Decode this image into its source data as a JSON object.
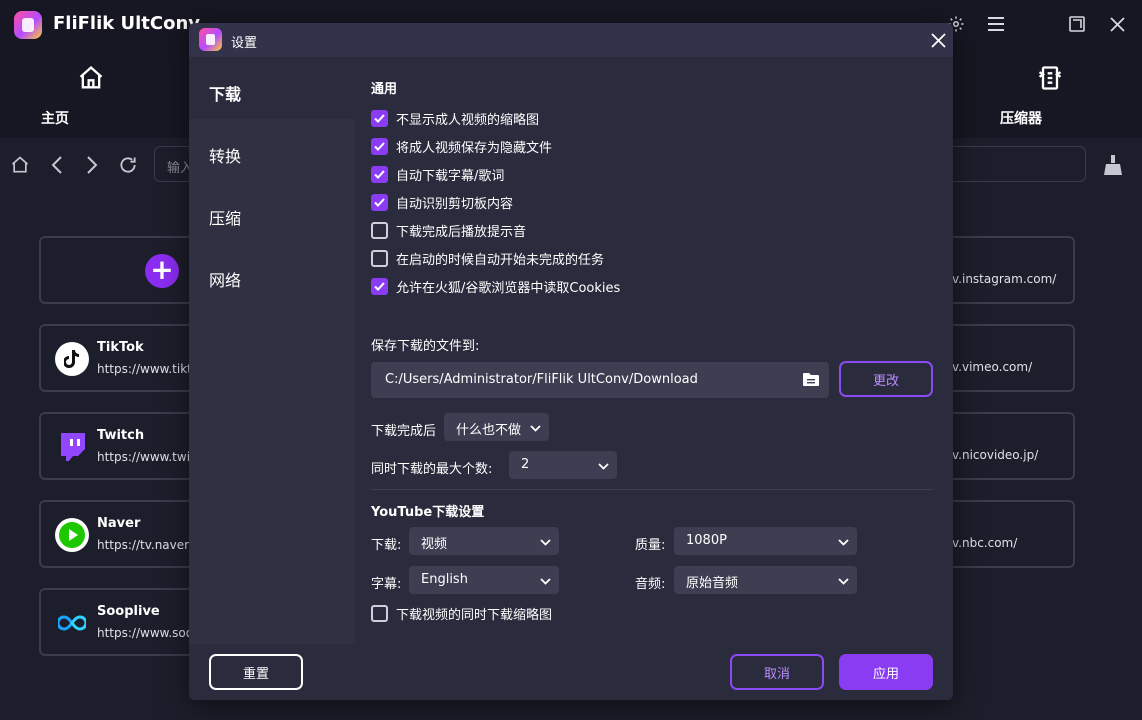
{
  "app": {
    "title": "FliFlik UltConv",
    "icons": [
      "settings-icon",
      "menu-icon",
      "maximize-icon",
      "close-icon"
    ]
  },
  "nav": {
    "home_label": "主页",
    "compressor_label": "压缩器"
  },
  "browser": {
    "url_placeholder": "输入"
  },
  "sites": {
    "tiktok": {
      "name": "TikTok",
      "url": "https://www.tiktc"
    },
    "twitch": {
      "name": "Twitch",
      "url": "https://www.twitc"
    },
    "naver": {
      "name": "Naver",
      "url": "https://tv.naver.c"
    },
    "sooplive": {
      "name": "Sooplive",
      "url": "https://www.soop"
    },
    "right_urls": [
      "v.instagram.com/",
      "v.vimeo.com/",
      "v.nicovideo.jp/",
      "v.nbc.com/"
    ]
  },
  "dialog": {
    "title": "设置",
    "sidebar": [
      {
        "label": "下载",
        "active": true
      },
      {
        "label": "转换",
        "active": false
      },
      {
        "label": "压缩",
        "active": false
      },
      {
        "label": "网络",
        "active": false
      }
    ],
    "general": {
      "section_title": "通用",
      "checkboxes": [
        {
          "label": "不显示成人视频的缩略图",
          "checked": true
        },
        {
          "label": "将成人视频保存为隐藏文件",
          "checked": true
        },
        {
          "label": "自动下载字幕/歌词",
          "checked": true
        },
        {
          "label": "自动识别剪切板内容",
          "checked": true
        },
        {
          "label": "下载完成后播放提示音",
          "checked": false
        },
        {
          "label": "在启动的时候自动开始未完成的任务",
          "checked": false
        },
        {
          "label": "允许在火狐/谷歌浏览器中读取Cookies",
          "checked": true
        }
      ],
      "save_to_label": "保存下载的文件到:",
      "save_path": "C:/Users/Administrator/FliFlik UltConv/Download",
      "change_button": "更改",
      "after_download_label": "下载完成后",
      "after_download_value": "什么也不做",
      "max_concurrent_label": "同时下载的最大个数:",
      "max_concurrent_value": "2"
    },
    "youtube": {
      "section_title": "YouTube下载设置",
      "download_label": "下载:",
      "download_value": "视频",
      "quality_label": "质量:",
      "quality_value": "1080P",
      "subtitle_label": "字幕:",
      "subtitle_value": "English",
      "audio_label": "音频:",
      "audio_value": "原始音频",
      "thumbnail_checkbox": {
        "label": "下载视频的同时下载缩略图",
        "checked": false
      }
    },
    "footer": {
      "reset_button": "重置",
      "cancel_button": "取消",
      "apply_button": "应用"
    },
    "colors": {
      "accent": "#8a3cf2",
      "background": "#2a2b3c"
    }
  }
}
